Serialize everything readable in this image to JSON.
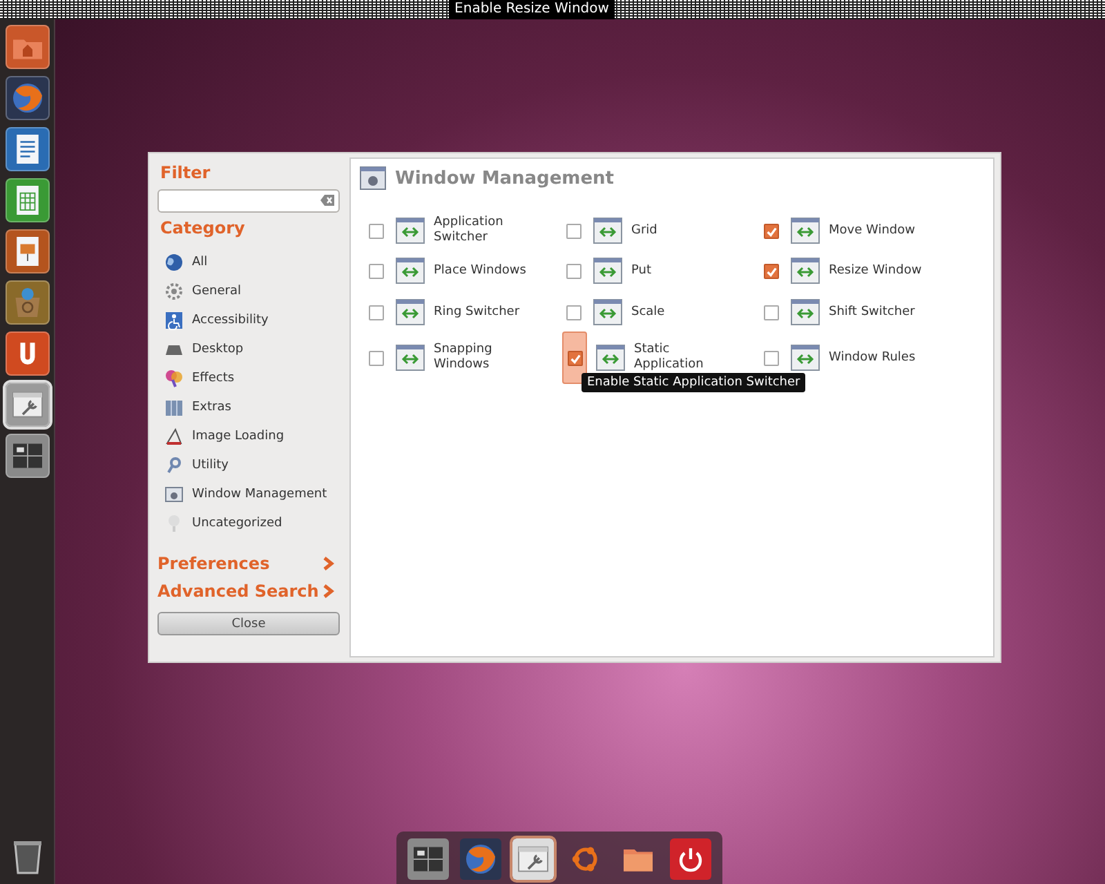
{
  "top_panel": {
    "tooltip": "Enable Resize Window"
  },
  "launcher": [
    {
      "kind": "home"
    },
    {
      "kind": "browser"
    },
    {
      "kind": "writer"
    },
    {
      "kind": "calc"
    },
    {
      "kind": "impress"
    },
    {
      "kind": "software"
    },
    {
      "kind": "ubuntuone"
    },
    {
      "kind": "settings",
      "active": true
    },
    {
      "kind": "workspaces"
    }
  ],
  "dialog": {
    "filter": {
      "title": "Filter"
    },
    "category_title": "Category",
    "categories": [
      {
        "label": "All",
        "selected": false
      },
      {
        "label": "General",
        "selected": false
      },
      {
        "label": "Accessibility",
        "selected": false
      },
      {
        "label": "Desktop",
        "selected": false
      },
      {
        "label": "Effects",
        "selected": false
      },
      {
        "label": "Extras",
        "selected": false
      },
      {
        "label": "Image Loading",
        "selected": false
      },
      {
        "label": "Utility",
        "selected": false
      },
      {
        "label": "Window Management",
        "selected": false
      },
      {
        "label": "Uncategorized",
        "selected": false
      }
    ],
    "links": [
      "Preferences",
      "Advanced Search"
    ],
    "close_button": "Close",
    "section_title": "Window Management",
    "plugins": [
      {
        "label": "Application Switcher",
        "checked": false
      },
      {
        "label": "Grid",
        "checked": false
      },
      {
        "label": "Move Window",
        "checked": true
      },
      {
        "label": "Place Windows",
        "checked": false
      },
      {
        "label": "Put",
        "checked": false
      },
      {
        "label": "Resize Window",
        "checked": true
      },
      {
        "label": "Ring Switcher",
        "checked": false
      },
      {
        "label": "Scale",
        "checked": false
      },
      {
        "label": "Shift Switcher",
        "checked": false
      },
      {
        "label": "Snapping Windows",
        "checked": false
      },
      {
        "label": "Static Application",
        "checked": true,
        "hovered": true,
        "tooltip": "Enable Static Application Switcher"
      },
      {
        "label": "Window Rules",
        "checked": false
      }
    ]
  },
  "dock": [
    {
      "kind": "workspaces"
    },
    {
      "kind": "browser"
    },
    {
      "kind": "settings",
      "active": true
    },
    {
      "kind": "ubuntu"
    },
    {
      "kind": "folder"
    },
    {
      "kind": "power"
    }
  ]
}
